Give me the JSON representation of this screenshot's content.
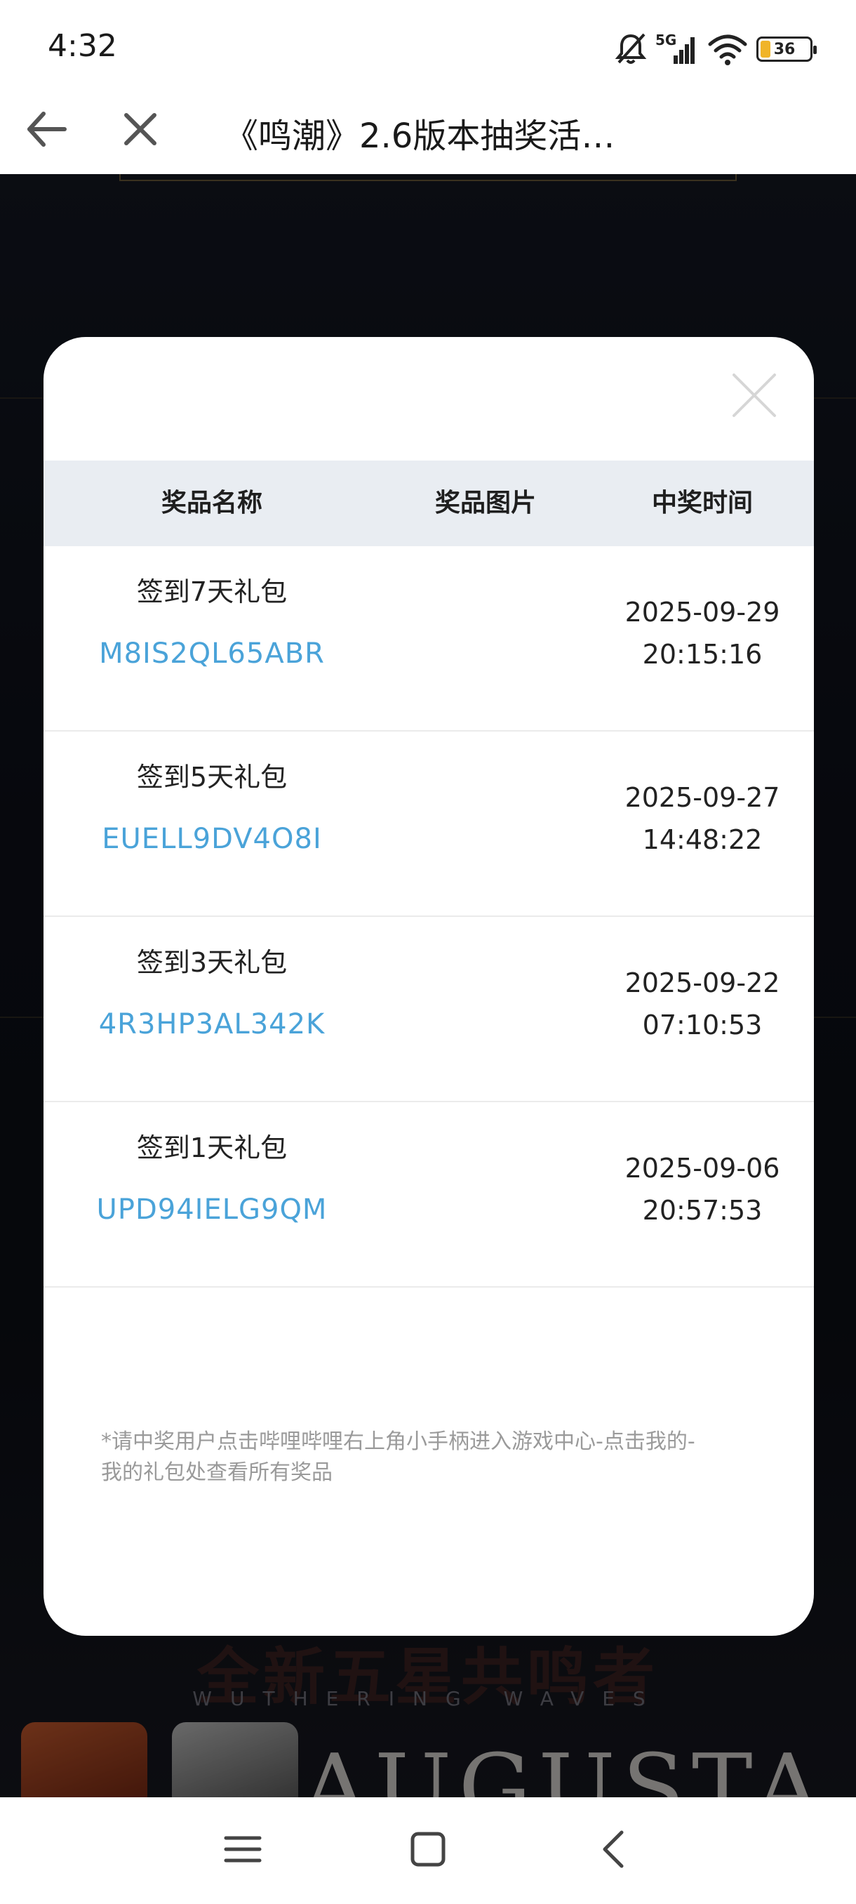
{
  "status_bar": {
    "time": "4:32",
    "network": "5G",
    "battery": "36",
    "icons": [
      "bell-off-icon",
      "signal-icon",
      "wifi-icon",
      "battery-icon"
    ]
  },
  "nav": {
    "title": "《鸣潮》2.6版本抽奖活…",
    "icons": [
      "back-arrow-icon",
      "close-icon"
    ]
  },
  "background": {
    "heading": "全新五星共鸣者",
    "subtitle": "WUTHERING WAVES",
    "big_text": "AUGUSTA"
  },
  "modal": {
    "headers": {
      "name": "奖品名称",
      "image": "奖品图片",
      "time": "中奖时间"
    },
    "rows": [
      {
        "name": "签到7天礼包",
        "code": "M8IS2QL65ABR",
        "date": "2025-09-29",
        "time": "20:15:16"
      },
      {
        "name": "签到5天礼包",
        "code": "EUELL9DV4O8I",
        "date": "2025-09-27",
        "time": "14:48:22"
      },
      {
        "name": "签到3天礼包",
        "code": "4R3HP3AL342K",
        "date": "2025-09-22",
        "time": "07:10:53"
      },
      {
        "name": "签到1天礼包",
        "code": "UPD94IELG9QM",
        "date": "2025-09-06",
        "time": "20:57:53"
      }
    ],
    "footnote_line1": "*请中奖用户点击哔哩哔哩右上角小手柄进入游戏中心-点击我的-",
    "footnote_line2": "我的礼包处查看所有奖品"
  },
  "colors": {
    "code_link": "#4aa3d9",
    "header_bg": "#e9edf2",
    "battery_fill": "#f0b429"
  }
}
